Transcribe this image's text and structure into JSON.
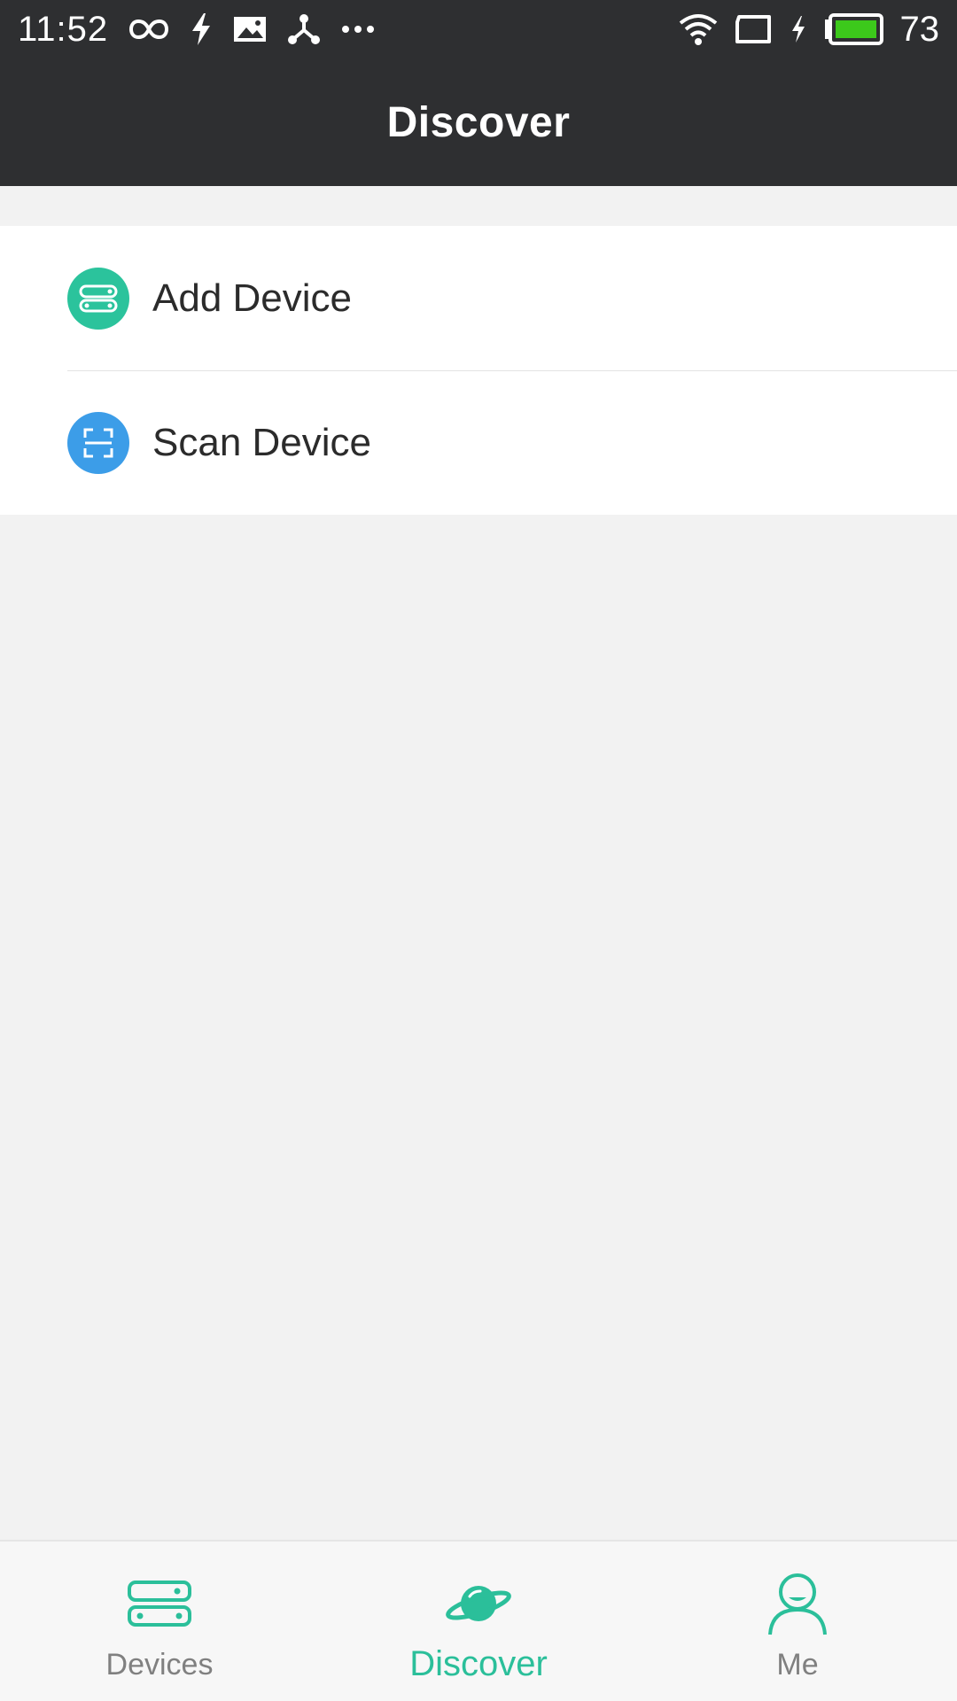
{
  "status_bar": {
    "time": "11:52",
    "battery_level": "73",
    "icons_left": [
      "infinity-icon",
      "bolt-icon",
      "image-icon",
      "share-hub-icon",
      "more-dots-icon"
    ],
    "icons_right": [
      "wifi-icon",
      "screen-icon",
      "charging-icon",
      "battery-icon"
    ]
  },
  "header": {
    "title": "Discover"
  },
  "menu": {
    "items": [
      {
        "label": "Add Device",
        "icon": "device-add-icon",
        "icon_color": "#2bc39c"
      },
      {
        "label": "Scan Device",
        "icon": "scan-icon",
        "icon_color": "#3c9de8"
      }
    ]
  },
  "bottom_nav": {
    "items": [
      {
        "label": "Devices",
        "icon": "devices-icon",
        "active": false
      },
      {
        "label": "Discover",
        "icon": "planet-icon",
        "active": true
      },
      {
        "label": "Me",
        "icon": "person-icon",
        "active": false
      }
    ]
  },
  "colors": {
    "header_bg": "#2e2f31",
    "accent": "#2bbf9a",
    "scan_blue": "#3c9de8",
    "battery_fill": "#3cc91b",
    "page_bg": "#f2f2f2"
  }
}
